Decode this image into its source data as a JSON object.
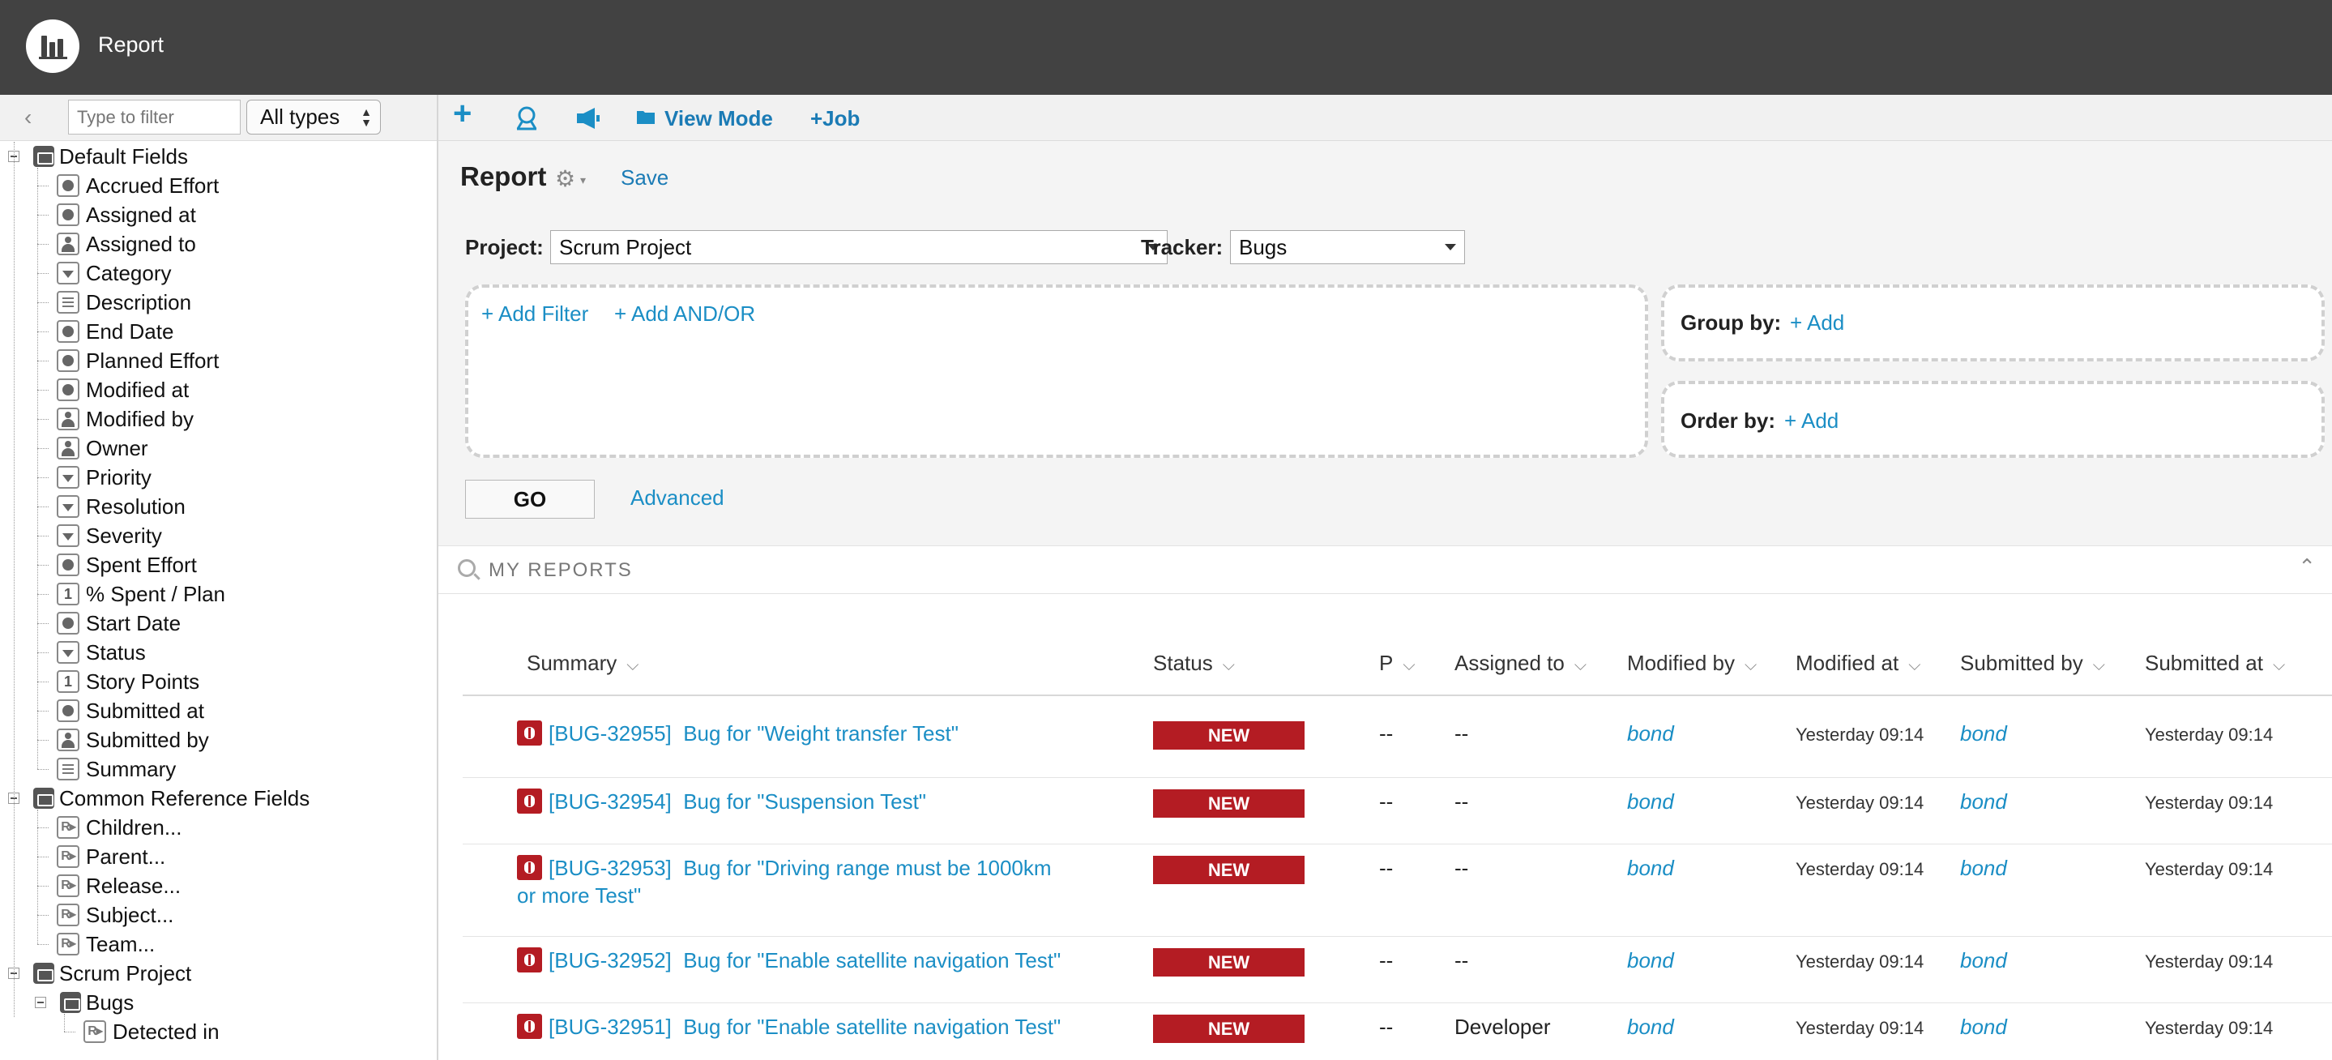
{
  "app": {
    "title": "Report"
  },
  "left_panel": {
    "collapse_glyph": "‹",
    "filter_placeholder": "Type to filter",
    "types_select": "All types",
    "groups": [
      {
        "label": "Default Fields",
        "fields": [
          {
            "label": "Accrued Effort",
            "icon": "clock-icon"
          },
          {
            "label": "Assigned at",
            "icon": "clock-icon"
          },
          {
            "label": "Assigned to",
            "icon": "user-icon"
          },
          {
            "label": "Category",
            "icon": "choice-icon"
          },
          {
            "label": "Description",
            "icon": "text-icon"
          },
          {
            "label": "End Date",
            "icon": "clock-icon"
          },
          {
            "label": "Planned Effort",
            "icon": "clock-icon"
          },
          {
            "label": "Modified at",
            "icon": "clock-icon"
          },
          {
            "label": "Modified by",
            "icon": "user-icon"
          },
          {
            "label": "Owner",
            "icon": "user-icon"
          },
          {
            "label": "Priority",
            "icon": "choice-icon"
          },
          {
            "label": "Resolution",
            "icon": "choice-icon"
          },
          {
            "label": "Severity",
            "icon": "choice-icon"
          },
          {
            "label": "Spent Effort",
            "icon": "clock-icon"
          },
          {
            "label": "% Spent / Plan",
            "icon": "number-icon"
          },
          {
            "label": "Start Date",
            "icon": "clock-icon"
          },
          {
            "label": "Status",
            "icon": "choice-icon"
          },
          {
            "label": "Story Points",
            "icon": "number-icon"
          },
          {
            "label": "Submitted at",
            "icon": "clock-icon"
          },
          {
            "label": "Submitted by",
            "icon": "user-icon"
          },
          {
            "label": "Summary",
            "icon": "text-icon"
          }
        ]
      },
      {
        "label": "Common Reference Fields",
        "fields": [
          {
            "label": "Children...",
            "icon": "reference-icon"
          },
          {
            "label": "Parent...",
            "icon": "reference-icon"
          },
          {
            "label": "Release...",
            "icon": "reference-icon"
          },
          {
            "label": "Subject...",
            "icon": "reference-icon"
          },
          {
            "label": "Team...",
            "icon": "reference-icon"
          }
        ]
      },
      {
        "label": "Scrum Project",
        "subgroup": "Bugs",
        "fields": [
          {
            "label": "Detected in",
            "icon": "reference-icon"
          }
        ]
      }
    ],
    "number_glyph": "1",
    "reference_glyph": "R▸"
  },
  "toolbar": {
    "add_glyph": "+",
    "view_mode": "View Mode",
    "job": "+Job"
  },
  "report": {
    "title": "Report",
    "gear_glyph": "⚙",
    "gear_arrow": "▾",
    "save": "Save",
    "project_label": "Project:",
    "project_value": "Scrum Project",
    "tracker_label": "Tracker:",
    "tracker_value": "Bugs",
    "add_filter": "+ Add Filter",
    "add_andor": "+ Add AND/OR",
    "group_by_label": "Group by:",
    "group_by_add": "+ Add",
    "order_by_label": "Order by:",
    "order_by_add": "+ Add",
    "go": "GO",
    "advanced": "Advanced"
  },
  "my_reports": {
    "title": "MY REPORTS",
    "toggle_glyph": "⌃"
  },
  "table": {
    "chevron": "⌵",
    "columns": [
      "Summary",
      "Status",
      "P",
      "Assigned to",
      "Modified by",
      "Modified at",
      "Submitted by",
      "Submitted at"
    ],
    "rows": [
      {
        "id": "[BUG-32955]",
        "title": "Bug for \"Weight transfer Test\"",
        "status": "NEW",
        "priority": "--",
        "assigned_to": "--",
        "modified_by": "bond",
        "modified_at": "Yesterday 09:14",
        "submitted_by": "bond",
        "submitted_at": "Yesterday 09:14"
      },
      {
        "id": "[BUG-32954]",
        "title": "Bug for \"Suspension Test\"",
        "status": "NEW",
        "priority": "--",
        "assigned_to": "--",
        "modified_by": "bond",
        "modified_at": "Yesterday 09:14",
        "submitted_by": "bond",
        "submitted_at": "Yesterday 09:14"
      },
      {
        "id": "[BUG-32953]",
        "title": "Bug for \"Driving range must be 1000km or more Test\"",
        "status": "NEW",
        "priority": "--",
        "assigned_to": "--",
        "modified_by": "bond",
        "modified_at": "Yesterday 09:14",
        "submitted_by": "bond",
        "submitted_at": "Yesterday 09:14"
      },
      {
        "id": "[BUG-32952]",
        "title": "Bug for \"Enable satellite navigation Test\"",
        "status": "NEW",
        "priority": "--",
        "assigned_to": "--",
        "modified_by": "bond",
        "modified_at": "Yesterday 09:14",
        "submitted_by": "bond",
        "submitted_at": "Yesterday 09:14"
      },
      {
        "id": "[BUG-32951]",
        "title": "Bug for \"Enable satellite navigation Test\"",
        "status": "NEW",
        "priority": "--",
        "assigned_to": "Developer",
        "modified_by": "bond",
        "modified_at": "Yesterday 09:14",
        "submitted_by": "bond",
        "submitted_at": "Yesterday 09:14"
      }
    ]
  },
  "colors": {
    "topbar": "#424242",
    "link": "#1b8ec5",
    "status_new": "#b41c23"
  }
}
